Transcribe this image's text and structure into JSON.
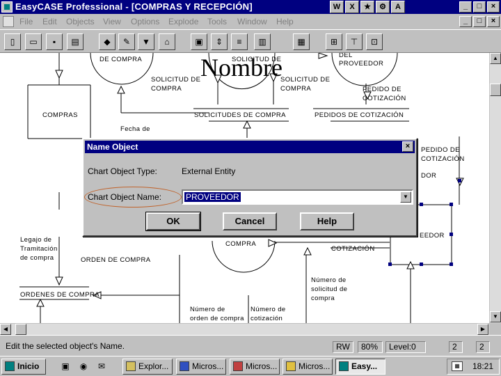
{
  "window": {
    "title": "EasyCASE Professional - [COMPRAS Y RECEPCIÓN]",
    "tray_icons": [
      "W",
      "X",
      "★",
      "⚙",
      "A"
    ]
  },
  "menu": {
    "items": [
      "File",
      "Edit",
      "Objects",
      "View",
      "Options",
      "Explode",
      "Tools",
      "Window",
      "Help"
    ]
  },
  "diagram": {
    "watermark": "Nombre",
    "labels": {
      "de_compra_top": "DE COMPRA",
      "solicitud_de_top": "SOLICITUD DE",
      "del_top": "DEL",
      "proveedor_top": "PROVEEDOR",
      "solicitud_de_compra_1": "SOLICITUD DE\nCOMPRA",
      "solicitud_de_compra_2": "SOLICITUD DE\nCOMPRA",
      "pedido_de_cotizacion_top": "PEDIDO DE\nCOTIZACIÓN",
      "compras": "COMPRAS",
      "solicitudes_de_compra": "SOLICITUDES DE COMPRA",
      "pedidos_de_cotizacion": "PEDIDOS DE COTIZACIÓN",
      "fecha_de": "Fecha de",
      "pedido_de_cotizacion_right": "PEDIDO DE\nCOTIZACIÓN",
      "dor": "DOR",
      "eedor": "EEDOR",
      "legajo": "Legajo de\nTramitación\nde compra",
      "compra_mid": "COMPRA",
      "cotizacion_mid": "COTIZACIÓN",
      "orden_de_compra": "ORDEN DE COMPRA",
      "numero_solicitud": "Número de\nsolicitud de\ncompra",
      "ordenes_de_compra": "ORDENES DE COMPRA",
      "numero_orden": "Número de\norden de compra",
      "numero_cotizacion": "Número de\ncotización"
    }
  },
  "dialog": {
    "title": "Name Object",
    "type_label": "Chart Object Type:",
    "type_value": "External Entity",
    "name_label": "Chart Object Name:",
    "name_value": "PROVEEDOR",
    "ok_label": "OK",
    "cancel_label": "Cancel",
    "help_label": "Help"
  },
  "status": {
    "message": "Edit the selected object's Name.",
    "mode": "RW",
    "zoom": "80%",
    "level": "Level:0",
    "field1": "2",
    "field2": "2"
  },
  "taskbar": {
    "start_label": "Inicio",
    "tasks": [
      "Explor...",
      "Micros...",
      "Micros...",
      "Micros...",
      "Easy..."
    ],
    "clock": "18:21"
  }
}
